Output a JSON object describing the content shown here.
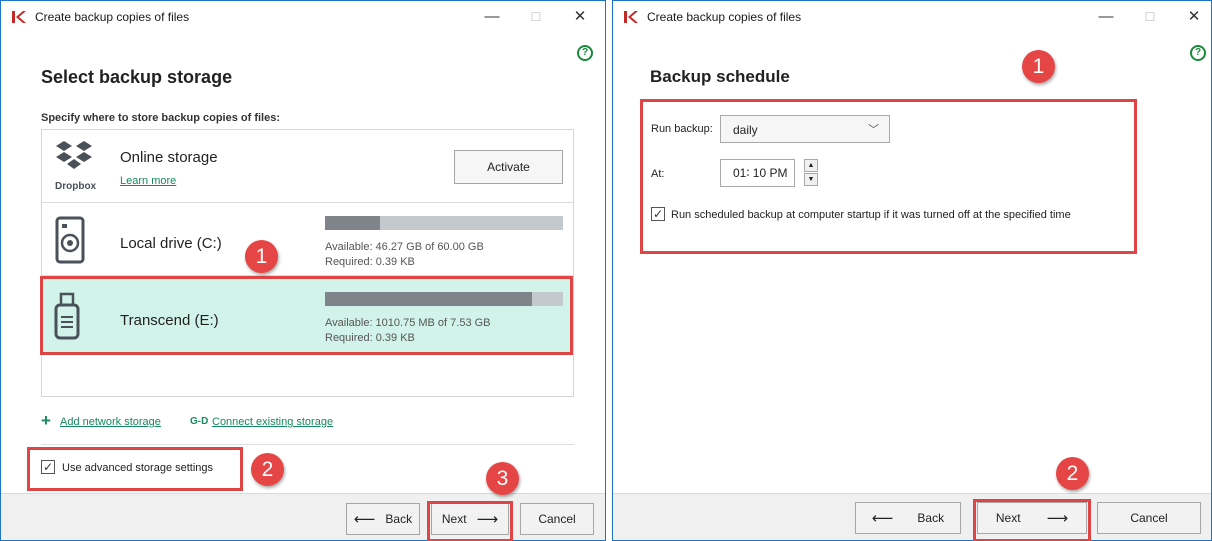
{
  "colors": {
    "accent_green": "#168a5e",
    "selection_bg": "#d2f3ea",
    "annotation_red": "#e04545",
    "window_border": "#1e74c8"
  },
  "left": {
    "title": "Create backup copies of files",
    "controls": {
      "minimize": "—",
      "maximize": "☐",
      "close": "✕"
    },
    "help_glyph": "?",
    "heading": "Select backup storage",
    "sublabel": "Specify where to store backup copies of files:",
    "storages": [
      {
        "name": "Online storage",
        "link": "Learn more",
        "button": "Activate",
        "logo_text": "Dropbox",
        "icon": "dropbox-icon"
      },
      {
        "name": "Local drive (C:)",
        "available": "Available: 46.27 GB of 60.00 GB",
        "required": "Required: 0.39 KB",
        "usage": 0.23,
        "icon": "hard-drive-icon"
      },
      {
        "name": "Transcend (E:)",
        "available": "Available: 1010.75 MB of 7.53 GB",
        "required": "Required: 0.39 KB",
        "usage": 0.87,
        "icon": "usb-drive-icon"
      }
    ],
    "add_network": "Add network storage",
    "connect_existing": "Connect existing storage",
    "advanced_checkbox": "Use advanced storage settings",
    "buttons": {
      "back": "Back",
      "next": "Next",
      "cancel": "Cancel"
    },
    "badges": [
      "1",
      "2",
      "3"
    ]
  },
  "right": {
    "title": "Create backup copies of files",
    "controls": {
      "minimize": "—",
      "maximize": "☐",
      "close": "✕"
    },
    "help_glyph": "?",
    "heading": "Backup schedule",
    "run_label": "Run backup:",
    "run_value": "daily",
    "at_label": "At:",
    "time_value": "01∶ 10  PM",
    "startup_checkbox": "Run scheduled backup at computer startup if it was turned off at the specified time",
    "buttons": {
      "back": "Back",
      "next": "Next",
      "cancel": "Cancel"
    },
    "badges": [
      "1",
      "2"
    ]
  }
}
